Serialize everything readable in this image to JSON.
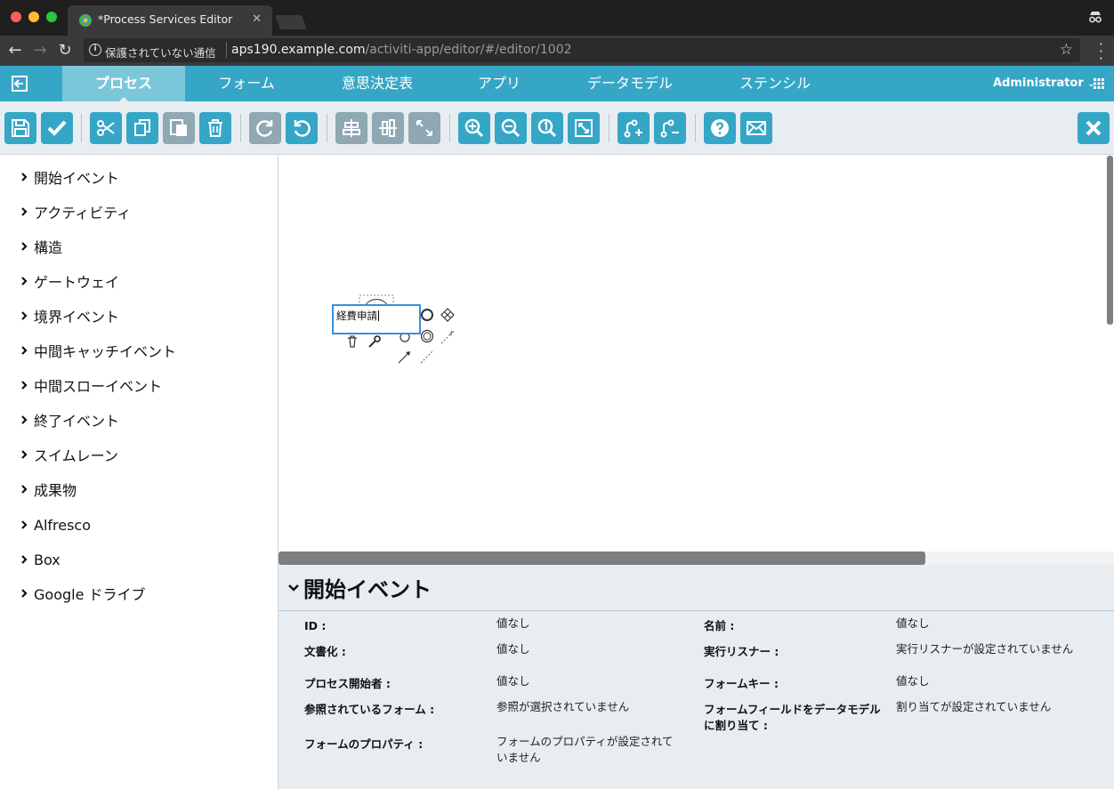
{
  "browser": {
    "tab_title": "*Process Services Editor",
    "url_insecure": "保護されていない通信",
    "url_host": "aps190.example.com",
    "url_path": "/activiti-app/editor/#/editor/1002"
  },
  "appnav": {
    "tabs": [
      {
        "label": "プロセス",
        "active": true
      },
      {
        "label": "フォーム",
        "active": false
      },
      {
        "label": "意思決定表",
        "active": false
      },
      {
        "label": "アプリ",
        "active": false
      },
      {
        "label": "データモデル",
        "active": false
      },
      {
        "label": "ステンシル",
        "active": false
      }
    ],
    "user": "Administrator"
  },
  "toolbar": {
    "buttons": [
      "save",
      "validate",
      "cut",
      "copy",
      "paste",
      "delete",
      "redo",
      "undo",
      "align-horizontal",
      "align-vertical",
      "same-size",
      "zoom-in",
      "zoom-out",
      "zoom-actual",
      "zoom-fit",
      "add-bendpoint",
      "remove-bendpoint",
      "help",
      "feedback",
      "close"
    ]
  },
  "palette": {
    "items": [
      "開始イベント",
      "アクティビティ",
      "構造",
      "ゲートウェイ",
      "境界イベント",
      "中間キャッチイベント",
      "中間スローイベント",
      "終了イベント",
      "スイムレーン",
      "成果物",
      "Alfresco",
      "Box",
      "Google ドライブ"
    ]
  },
  "canvas": {
    "label_text": "経費申請"
  },
  "properties": {
    "title": "開始イベント",
    "rows": [
      {
        "label": "ID :",
        "value": "値なし"
      },
      {
        "label": "名前 :",
        "value": "値なし"
      },
      {
        "label": "文書化 :",
        "value": "値なし"
      },
      {
        "label": "実行リスナー :",
        "value": "実行リスナーが設定されていません"
      },
      {
        "label": "プロセス開始者 :",
        "value": "値なし"
      },
      {
        "label": "フォームキー :",
        "value": "値なし"
      },
      {
        "label": "参照されているフォーム :",
        "value": "参照が選択されていません"
      },
      {
        "label": "フォームフィールドをデータモデルに割り当て :",
        "value": "割り当てが設定されていません"
      },
      {
        "label": "フォームのプロパティ :",
        "value": "フォームのプロパティが設定されていません"
      }
    ]
  },
  "colors": {
    "brand": "#36a6c6",
    "toolbar_bg": "#e8edf2",
    "selection": "#3a8de0"
  }
}
